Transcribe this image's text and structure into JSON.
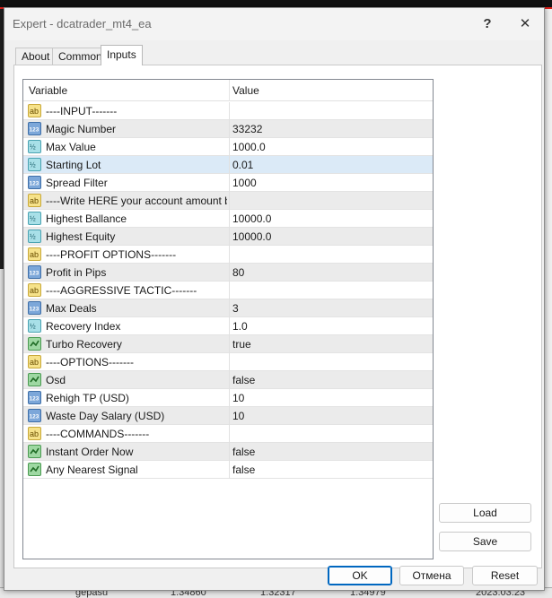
{
  "window": {
    "title": "Expert - dcatrader_mt4_ea",
    "help_glyph": "?",
    "close_glyph": "✕"
  },
  "tabs": [
    {
      "label": "About"
    },
    {
      "label": "Common"
    },
    {
      "label": "Inputs"
    }
  ],
  "grid": {
    "headers": {
      "variable": "Variable",
      "value": "Value"
    },
    "rows": [
      {
        "type": "ab",
        "name": "----INPUT-------",
        "value": ""
      },
      {
        "type": "int",
        "name": "Magic Number",
        "value": "33232"
      },
      {
        "type": "dbl",
        "name": "Max Value",
        "value": "1000.0"
      },
      {
        "type": "dbl",
        "name": "Starting Lot",
        "value": "0.01"
      },
      {
        "type": "int",
        "name": "Spread Filter",
        "value": "1000"
      },
      {
        "type": "ab",
        "name": "----Write HERE your account amount bef...",
        "value": ""
      },
      {
        "type": "dbl",
        "name": "Highest Ballance",
        "value": "10000.0"
      },
      {
        "type": "dbl",
        "name": "Highest Equity",
        "value": "10000.0"
      },
      {
        "type": "ab",
        "name": "----PROFIT OPTIONS-------",
        "value": ""
      },
      {
        "type": "int",
        "name": "Profit in Pips",
        "value": "80"
      },
      {
        "type": "ab",
        "name": "----AGGRESSIVE TACTIC-------",
        "value": ""
      },
      {
        "type": "int",
        "name": "Max Deals",
        "value": "3"
      },
      {
        "type": "dbl",
        "name": "Recovery Index",
        "value": "1.0"
      },
      {
        "type": "bool",
        "name": "Turbo Recovery",
        "value": "true"
      },
      {
        "type": "ab",
        "name": "----OPTIONS-------",
        "value": ""
      },
      {
        "type": "bool",
        "name": "Osd",
        "value": "false"
      },
      {
        "type": "int",
        "name": "Rehigh TP (USD)",
        "value": "10"
      },
      {
        "type": "int",
        "name": "Waste Day Salary (USD)",
        "value": "10"
      },
      {
        "type": "ab",
        "name": "----COMMANDS-------",
        "value": ""
      },
      {
        "type": "bool",
        "name": "Instant Order Now",
        "value": "false"
      },
      {
        "type": "bool",
        "name": "Any Nearest Signal",
        "value": "false"
      }
    ],
    "selected_row": "Starting Lot"
  },
  "buttons": {
    "load": "Load",
    "save": "Save",
    "ok": "OK",
    "cancel": "Отмена",
    "reset": "Reset"
  },
  "background": {
    "bottom_text_1": "gepasu",
    "bottom_text_2": "1.34860",
    "bottom_text_3": "1.32317",
    "bottom_text_4": "1.34979",
    "bottom_text_5": "2023.03.23"
  },
  "colors": {
    "selected_row": "#dbeaf7",
    "alt_row": "#ebebeb",
    "ok_border": "#0067c0"
  }
}
